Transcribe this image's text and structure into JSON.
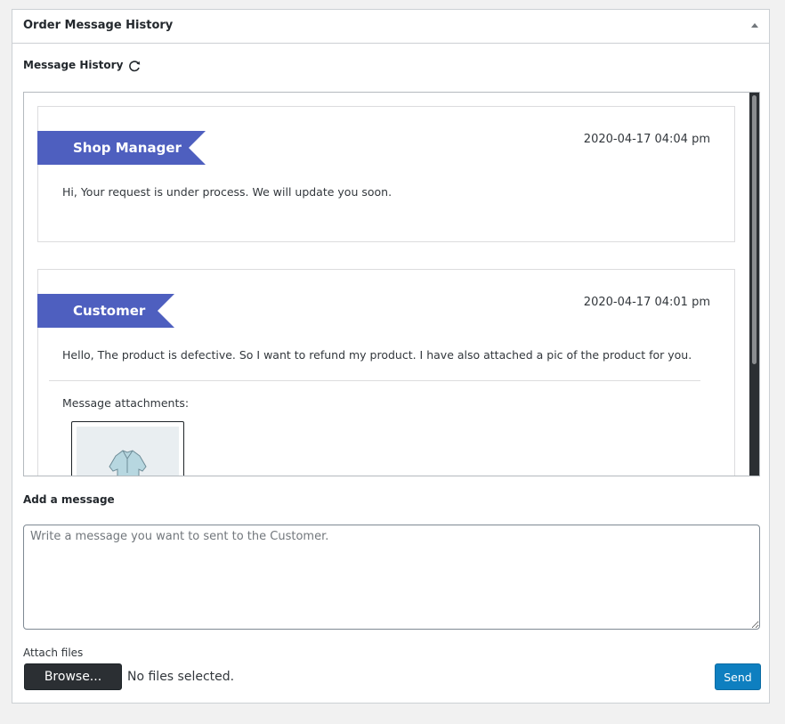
{
  "panel": {
    "title": "Order Message History"
  },
  "history": {
    "label": "Message History",
    "messages": [
      {
        "author": "Shop Manager",
        "timestamp": "2020-04-17 04:04 pm",
        "text": "Hi, Your request is under process. We will update you soon."
      },
      {
        "author": "Customer",
        "timestamp": "2020-04-17 04:01 pm",
        "text": "Hello, The product is defective. So I want to refund my product. I have also attached a pic of the product for you.",
        "attachments_label": "Message attachments:"
      }
    ]
  },
  "compose": {
    "label": "Add a message",
    "placeholder": "Write a message you want to sent to the Customer.",
    "attach_label": "Attach files",
    "browse_label": "Browse...",
    "file_status": "No files selected.",
    "send_label": "Send"
  },
  "colors": {
    "ribbon": "#4e5fbf",
    "send_button": "#0e7fc0"
  }
}
